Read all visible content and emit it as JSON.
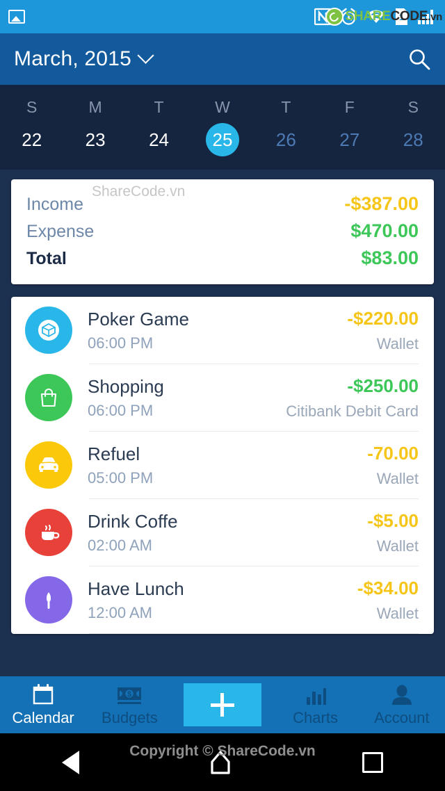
{
  "status_bar": {
    "icons": [
      "photo-icon",
      "nfc-icon",
      "alarm-icon",
      "wifi-icon",
      "sim-card-icon",
      "signal-icon"
    ],
    "sim_label": "1",
    "watermark": {
      "share": "SHARE",
      "code": "CODE",
      "tld": ".vn"
    },
    "bg": "#1e97da"
  },
  "app_bar": {
    "title": "March, 2015",
    "dropdown_icon": "chevron-down-icon",
    "search_icon": "search-icon",
    "bg": "#135a9c"
  },
  "week_strip": {
    "bg": "#16253f",
    "selected_color": "#29b6e8",
    "days": [
      {
        "dow": "S",
        "num": "22",
        "state": "normal"
      },
      {
        "dow": "M",
        "num": "23",
        "state": "normal"
      },
      {
        "dow": "T",
        "num": "24",
        "state": "normal"
      },
      {
        "dow": "W",
        "num": "25",
        "state": "selected"
      },
      {
        "dow": "T",
        "num": "26",
        "state": "dim"
      },
      {
        "dow": "F",
        "num": "27",
        "state": "dim"
      },
      {
        "dow": "S",
        "num": "28",
        "state": "dim"
      }
    ]
  },
  "summary": {
    "watermark": "ShareCode.vn",
    "rows": [
      {
        "label": "Income",
        "value": "-$387.00",
        "color": "#f5c518"
      },
      {
        "label": "Expense",
        "value": "$470.00",
        "color": "#3cc758"
      },
      {
        "label": "Total",
        "value": "$83.00",
        "color": "#3cc758"
      }
    ]
  },
  "transactions": [
    {
      "title": "Poker Game",
      "time": "06:00 PM",
      "amount": "-$220.00",
      "amount_color": "#f5c518",
      "account": "Wallet",
      "icon": "diamond-icon",
      "icon_bg": "#29b6e8"
    },
    {
      "title": "Shopping",
      "time": "06:00 PM",
      "amount": "-$250.00",
      "amount_color": "#3cc758",
      "account": "Citibank Debit Card",
      "icon": "shopping-bag-icon",
      "icon_bg": "#3cc758"
    },
    {
      "title": "Refuel",
      "time": "05:00 PM",
      "amount": "-70.00",
      "amount_color": "#f5c518",
      "account": "Wallet",
      "icon": "car-icon",
      "icon_bg": "#fcc80a"
    },
    {
      "title": "Drink Coffe",
      "time": "02:00 AM",
      "amount": "-$5.00",
      "amount_color": "#f5c518",
      "account": "Wallet",
      "icon": "coffee-cup-icon",
      "icon_bg": "#e8413a"
    },
    {
      "title": "Have Lunch",
      "time": "12:00 AM",
      "amount": "-$34.00",
      "amount_color": "#f5c518",
      "account": "Wallet",
      "icon": "knife-icon",
      "icon_bg": "#8468e8"
    }
  ],
  "bottom_nav": {
    "bg": "#1571b5",
    "fab_color": "#29b6e8",
    "items": [
      {
        "label": "Calendar",
        "icon": "calendar-icon",
        "active": true
      },
      {
        "label": "Budgets",
        "icon": "banknote-icon",
        "active": false
      },
      {
        "label": "Charts",
        "icon": "bar-chart-icon",
        "active": false
      },
      {
        "label": "Account",
        "icon": "person-icon",
        "active": false
      }
    ],
    "add_button": "+"
  },
  "android_nav": {
    "back": "back-icon",
    "home": "home-icon",
    "recents": "recents-icon",
    "watermark": "Copyright © ShareCode.vn"
  }
}
